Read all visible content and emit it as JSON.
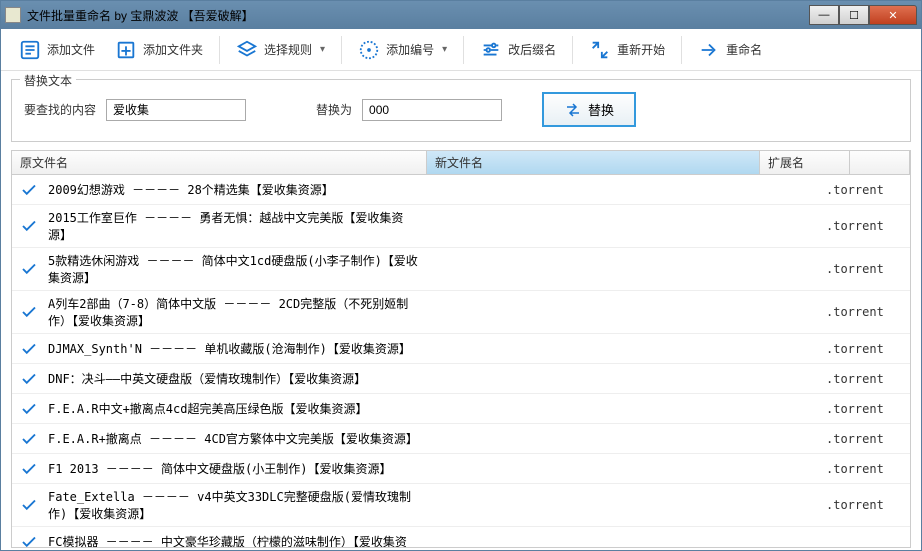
{
  "window_title": "文件批量重命名 by 宝鼎波波 【吾爱破解】",
  "toolbar": {
    "add_file": "添加文件",
    "add_folder": "添加文件夹",
    "select_rule": "选择规则",
    "add_number": "添加编号",
    "change_ext": "改后缀名",
    "restart": "重新开始",
    "rename": "重命名"
  },
  "group": {
    "title": "替换文本",
    "search_label": "要查找的内容",
    "search_value": "爱收集",
    "replace_label": "替换为",
    "replace_value": "000",
    "replace_btn": "替换"
  },
  "columns": {
    "original": "原文件名",
    "newname": "新文件名",
    "ext": "扩展名"
  },
  "rows": [
    {
      "name": "2009幻想游戏 －－－－ 28个精选集【爱收集资源】",
      "new": "",
      "ext": ".torrent"
    },
    {
      "name": "2015工作室巨作 －－－－ 勇者无惧：越战中文完美版【爱收集资源】",
      "new": "",
      "ext": ".torrent"
    },
    {
      "name": "5款精选休闲游戏 －－－－ 简体中文1cd硬盘版(小李子制作)【爱收集资源】",
      "new": "",
      "ext": ".torrent"
    },
    {
      "name": "A列车2部曲（7-8）简体中文版 －－－－ 2CD完整版（不死别姬制作）【爱收集资源】",
      "new": "",
      "ext": ".torrent"
    },
    {
      "name": "DJMAX_Synth'N －－－－ 单机收藏版(沧海制作)【爱收集资源】",
      "new": "",
      "ext": ".torrent"
    },
    {
      "name": "DNF：决斗――中英文硬盘版（爱情玫瑰制作）【爱收集资源】",
      "new": "",
      "ext": ".torrent"
    },
    {
      "name": "F.E.A.R中文+撤离点4cd超完美高压绿色版【爱收集资源】",
      "new": "",
      "ext": ".torrent"
    },
    {
      "name": "F.E.A.R+撤离点 －－－－ 4CD官方繁体中文完美版【爱收集资源】",
      "new": "",
      "ext": ".torrent"
    },
    {
      "name": "F1 2013 －－－－ 简体中文硬盘版(小王制作)【爱收集资源】",
      "new": "",
      "ext": ".torrent"
    },
    {
      "name": "Fate_Extella －－－－ v4中英文33DLC完整硬盘版(爱情玫瑰制作)【爱收集资源】",
      "new": "",
      "ext": ".torrent"
    },
    {
      "name": "FC模拟器 －－－－ 中文豪华珍藏版（柠檬的滋味制作）【爱收集资",
      "new": "",
      "ext": ""
    }
  ]
}
